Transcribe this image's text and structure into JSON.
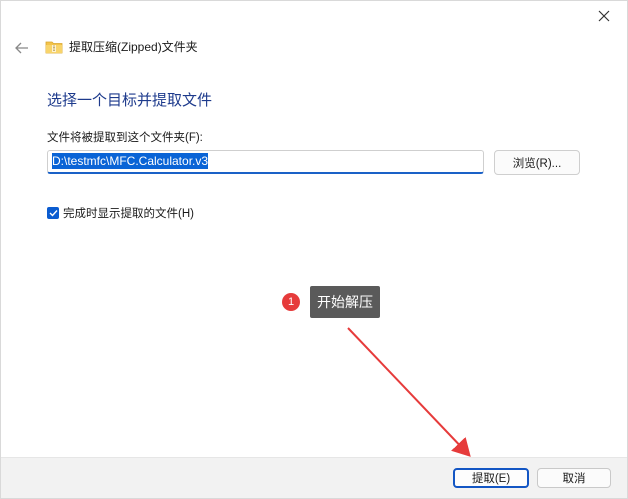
{
  "window": {
    "title": "提取压缩(Zipped)文件夹",
    "close_icon": "close-icon",
    "back_icon": "back-arrow-icon",
    "folder_icon": "zip-folder-icon"
  },
  "main": {
    "heading": "选择一个目标并提取文件",
    "path_label": "文件将被提取到这个文件夹(F):",
    "path_value": "D:\\testmfc\\MFC.Calculator.v3",
    "browse_label": "浏览(R)...",
    "show_files_label": "完成时显示提取的文件(H)",
    "show_files_checked": true
  },
  "footer": {
    "extract_label": "提取(E)",
    "cancel_label": "取消"
  },
  "annotation": {
    "badge_number": "1",
    "text": "开始解压",
    "color": "#e63b3b"
  },
  "colors": {
    "heading": "#1d3a8c",
    "accent": "#0b5cd0"
  }
}
